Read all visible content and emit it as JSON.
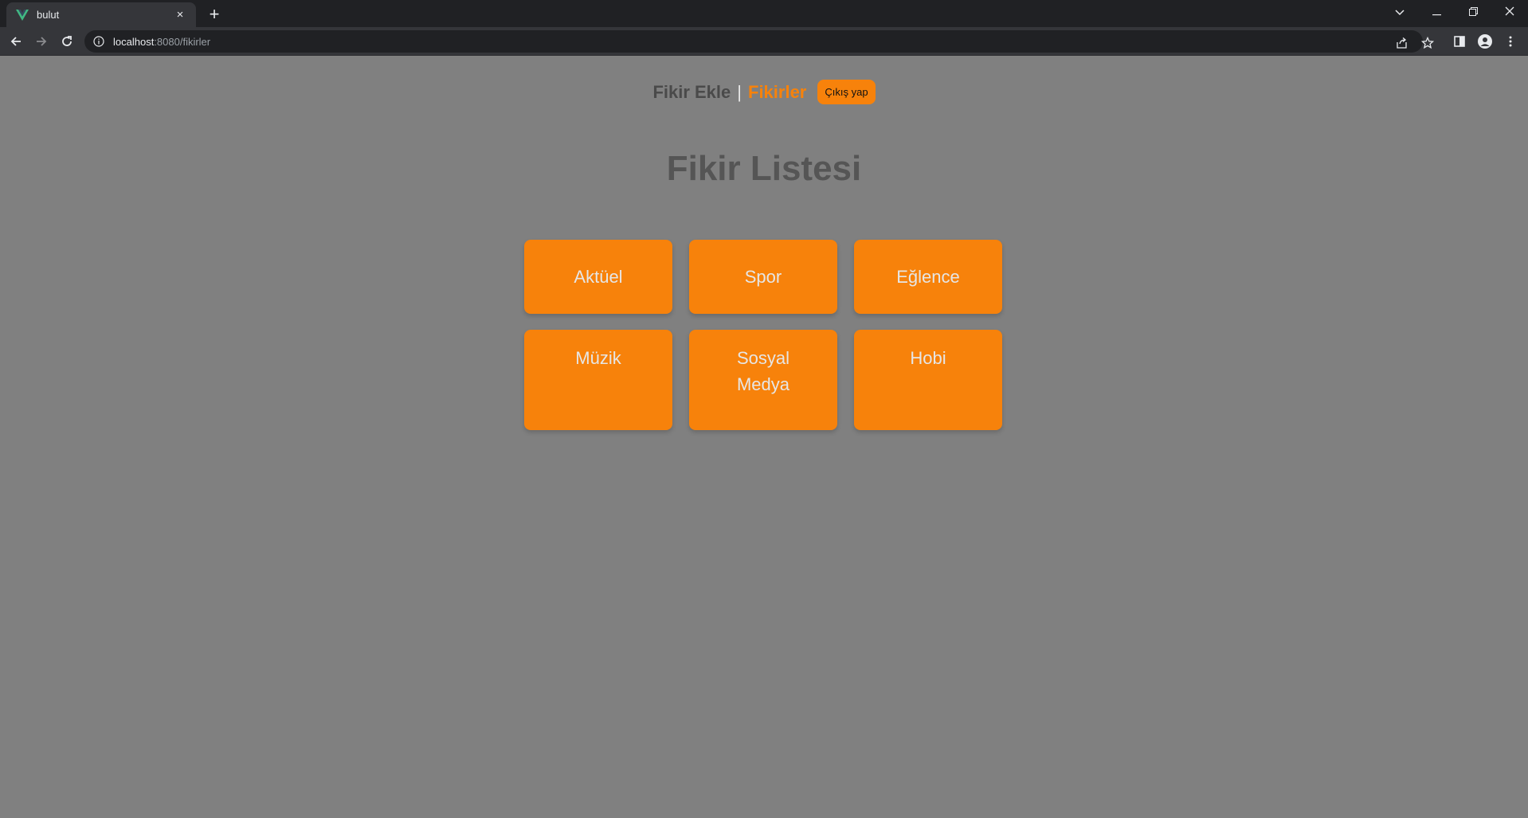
{
  "browser": {
    "tab_title": "bulut",
    "tab_close": "×",
    "new_tab": "+",
    "url_host": "localhost",
    "url_rest": ":8080/fikirler",
    "accent_favicon": "#41b883"
  },
  "nav": {
    "add_idea": "Fikir Ekle",
    "separator": "|",
    "ideas": "Fikirler",
    "logout": "Çıkış yap"
  },
  "page": {
    "title": "Fikir Listesi"
  },
  "categories": [
    {
      "label": "Aktüel"
    },
    {
      "label": "Spor"
    },
    {
      "label": "Eğlence"
    },
    {
      "label": "Müzik"
    },
    {
      "label": "Sosyal Medya"
    },
    {
      "label": "Hobi"
    }
  ],
  "colors": {
    "accent": "#f7820b",
    "background": "#808080"
  }
}
